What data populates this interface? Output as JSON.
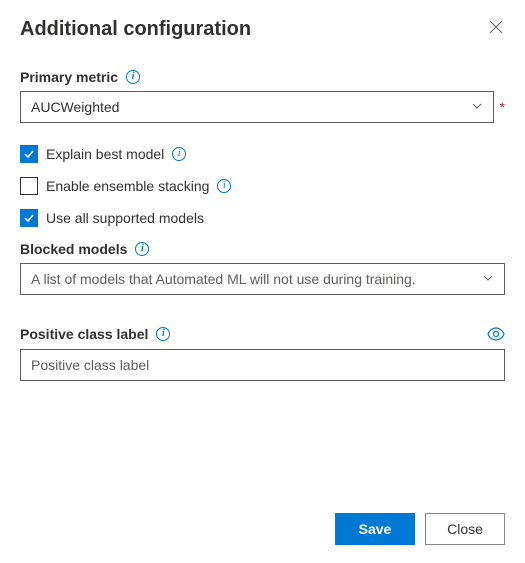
{
  "header": {
    "title": "Additional configuration"
  },
  "primaryMetric": {
    "label": "Primary metric",
    "value": "AUCWeighted",
    "required": "*"
  },
  "checkboxes": {
    "explainBest": {
      "label": "Explain best model",
      "checked": true,
      "hasInfo": true
    },
    "enableStacking": {
      "label": "Enable ensemble stacking",
      "checked": false,
      "hasInfo": true
    },
    "useAllModels": {
      "label": "Use all supported models",
      "checked": true,
      "hasInfo": false
    }
  },
  "blockedModels": {
    "label": "Blocked models",
    "placeholder": "A list of models that Automated ML will not use during training."
  },
  "positiveClass": {
    "label": "Positive class label",
    "placeholder": "Positive class label"
  },
  "footer": {
    "save": "Save",
    "close": "Close"
  }
}
